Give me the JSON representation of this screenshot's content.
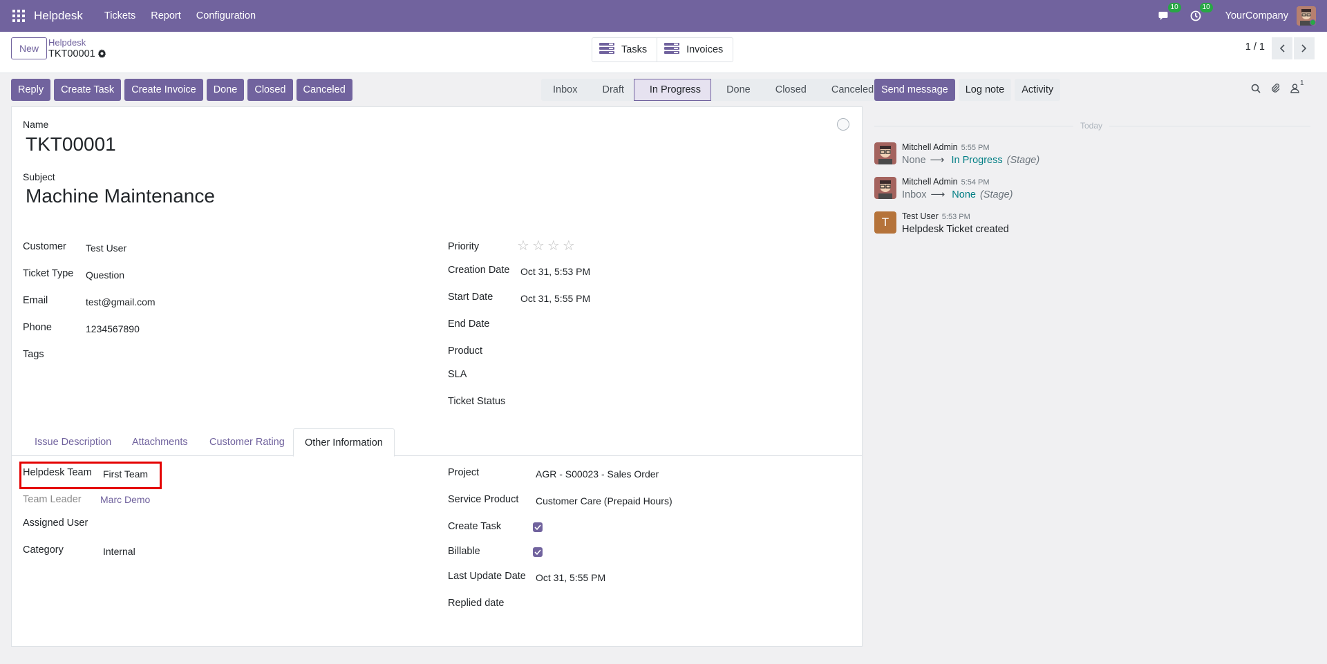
{
  "navbar": {
    "brand": "Helpdesk",
    "menu": [
      "Tickets",
      "Report",
      "Configuration"
    ],
    "messages_count": "10",
    "activities_count": "10",
    "company": "YourCompany",
    "accent": "#71639e"
  },
  "control": {
    "new_label": "New",
    "breadcrumb_parent": "Helpdesk",
    "record_name": "TKT00001",
    "smart_buttons": [
      "Tasks",
      "Invoices"
    ],
    "pager": "1 / 1"
  },
  "actions": [
    "Reply",
    "Create Task",
    "Create Invoice",
    "Done",
    "Closed",
    "Canceled"
  ],
  "stages": [
    "Inbox",
    "Draft",
    "In Progress",
    "Done",
    "Closed",
    "Canceled"
  ],
  "active_stage": "In Progress",
  "form": {
    "name_label": "Name",
    "name_value": "TKT00001",
    "subject_label": "Subject",
    "subject_value": "Machine Maintenance",
    "customer_label": "Customer",
    "customer_value": "Test User",
    "ticket_type_label": "Ticket Type",
    "ticket_type_value": "Question",
    "email_label": "Email",
    "email_value": "test@gmail.com",
    "phone_label": "Phone",
    "phone_value": "1234567890",
    "tags_label": "Tags",
    "priority_label": "Priority",
    "priority_stars_filled": 0,
    "priority_stars_total": 4,
    "creation_date_label": "Creation Date",
    "creation_date_value": "Oct 31, 5:53 PM",
    "start_date_label": "Start Date",
    "start_date_value": "Oct 31, 5:55 PM",
    "end_date_label": "End Date",
    "product_label": "Product",
    "sla_label": "SLA",
    "ticket_status_label": "Ticket Status"
  },
  "tabs": [
    "Issue Description",
    "Attachments",
    "Customer Rating",
    "Other Information"
  ],
  "active_tab": "Other Information",
  "other_info": {
    "helpdesk_team_label": "Helpdesk Team",
    "helpdesk_team_value": "First Team",
    "team_leader_label": "Team Leader",
    "team_leader_value": "Marc Demo",
    "assigned_user_label": "Assigned User",
    "category_label": "Category",
    "category_value": "Internal",
    "project_label": "Project",
    "project_value": "AGR - S00023 - Sales Order",
    "service_product_label": "Service Product",
    "service_product_value": "Customer Care (Prepaid Hours)",
    "create_task_label": "Create Task",
    "create_task_checked": true,
    "billable_label": "Billable",
    "billable_checked": true,
    "last_update_label": "Last Update Date",
    "last_update_value": "Oct 31, 5:55 PM",
    "replied_date_label": "Replied date"
  },
  "chatter": {
    "buttons": [
      "Send message",
      "Log note",
      "Activity"
    ],
    "followers_count": "1",
    "date_separator": "Today",
    "messages": [
      {
        "author": "Mitchell Admin",
        "time": "5:55 PM",
        "prev": "None",
        "new": "In Progress",
        "field": "(Stage)"
      },
      {
        "author": "Mitchell Admin",
        "time": "5:54 PM",
        "prev": "Inbox",
        "new": "None",
        "field": "(Stage)"
      },
      {
        "author": "Test User",
        "time": "5:53 PM",
        "body": "Helpdesk Ticket created",
        "initial": "T"
      }
    ]
  }
}
